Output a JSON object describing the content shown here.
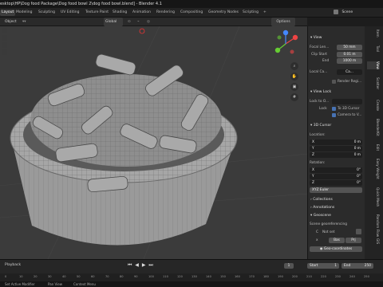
{
  "window": {
    "title": "esktop\\HP\\Dog food Package\\Dog food bowl 2\\dog food bowl.blend] - Blender 4.1"
  },
  "workspaces": [
    "Layout",
    "Modeling",
    "Sculpting",
    "UV Editing",
    "Texture Paint",
    "Shading",
    "Animation",
    "Rendering",
    "Compositing",
    "Geometry Nodes",
    "Scripting",
    "+"
  ],
  "scene": {
    "label": "Scene"
  },
  "viewport_header": {
    "mode": "Object",
    "global": "Global",
    "options": "Options"
  },
  "npanel": {
    "view_section": "View",
    "focal_length_label": "Focal Len...",
    "focal_length_value": "50 mm",
    "clip_start_label": "Clip Start",
    "clip_start_value": "0.01 m",
    "end_label": "End",
    "end_value": "1000 m",
    "local_camera_label": "Local Ca...",
    "local_camera_value": "Ca...",
    "render_region_label": "Render Regi...",
    "view_lock_section": "View Lock",
    "lock_to_label": "Lock to O...",
    "lock_label": "Lock",
    "to_3d_cursor_label": "To 3D Cursor",
    "camera_to_view_label": "Camera to V...",
    "cursor_section": "3D Cursor",
    "location_label": "Location:",
    "loc_x_label": "X",
    "loc_x_value": "0 m",
    "loc_y_label": "Y",
    "loc_y_value": "0 m",
    "loc_z_label": "Z",
    "loc_z_value": "0 m",
    "rotation_label": "Rotation:",
    "rot_x_label": "X",
    "rot_x_value": "0°",
    "rot_y_label": "Y",
    "rot_y_value": "0°",
    "rot_z_label": "Z",
    "rot_z_value": "0°",
    "rotation_mode": "XYZ Euler",
    "collections_section": "Collections",
    "annotations_section": "Annotations",
    "geoscene_section": "Geoscene",
    "georef_label": "Scene georeferencing",
    "crs_label": "C",
    "crs_value": "Not set",
    "bas_label": "Bas",
    "prj_label": "Prj",
    "geo_coords_button": "Geo-coordinates"
  },
  "sidebar_tabs": [
    "Item",
    "Tool",
    "View",
    "Scatter",
    "Create",
    "BlenderKit",
    "Edit",
    "Easy Weight",
    "Quick Mesh",
    "Random Flow",
    "GIS",
    "MaterialUtility"
  ],
  "timeline": {
    "playback_label": "Playback",
    "start_label": "Start",
    "start_value": "1",
    "end_label": "End",
    "end_value": "250",
    "frame_value": "1",
    "ticks": [
      "0",
      "10",
      "20",
      "30",
      "40",
      "50",
      "60",
      "70",
      "80",
      "90",
      "100",
      "110",
      "120",
      "130",
      "140",
      "150",
      "160",
      "170",
      "180",
      "190",
      "200",
      "210",
      "220",
      "230",
      "240",
      "250"
    ]
  },
  "status": {
    "left": "Set Active Modifier",
    "middle": "Pan View",
    "right": "Context Menu"
  },
  "colors": {
    "accent": "#4772b3",
    "viewport_bg": "#3b3b3b",
    "bowl": "#9a9a9a"
  }
}
